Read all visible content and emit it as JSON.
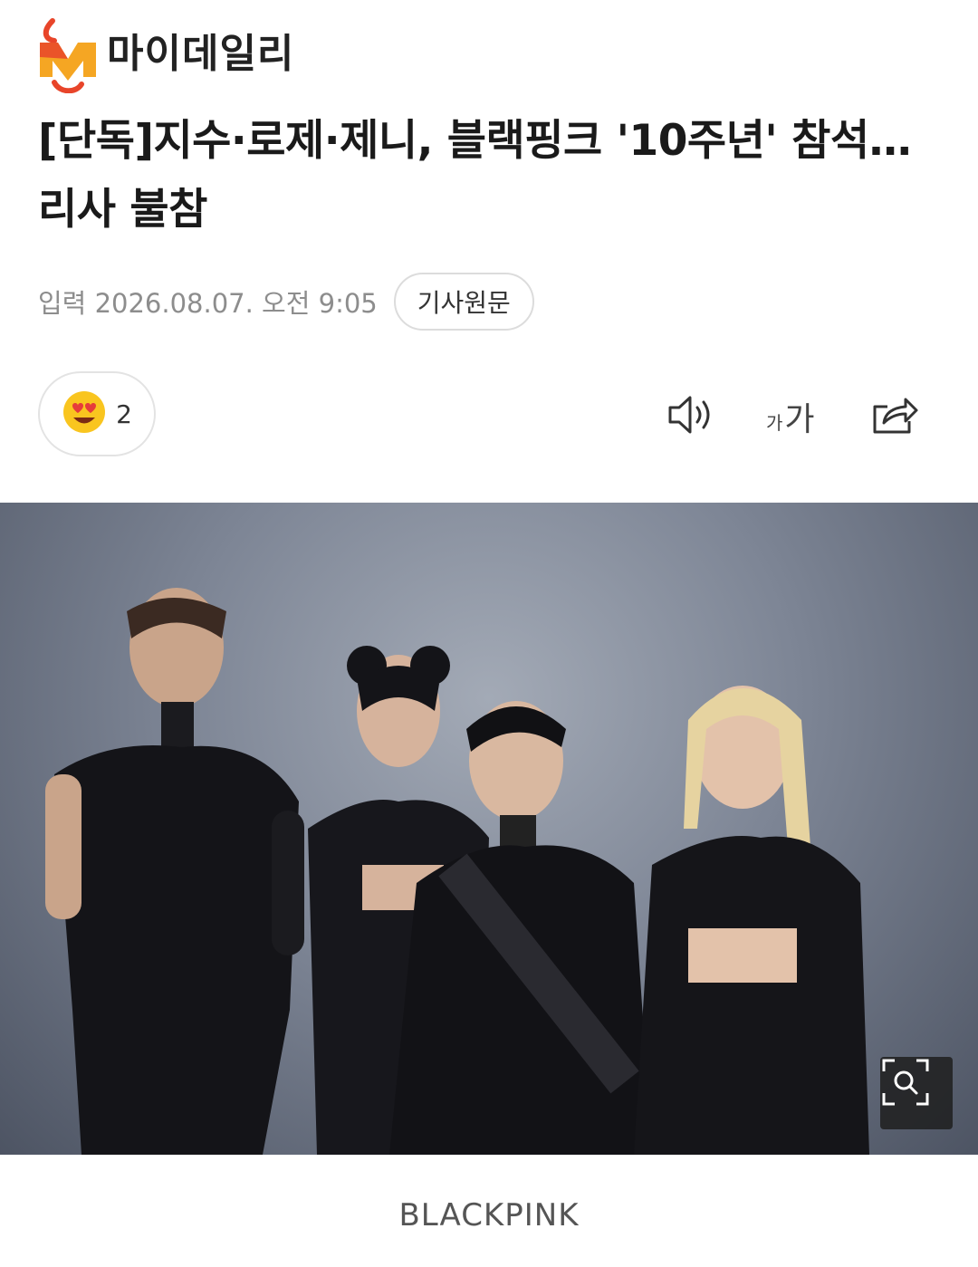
{
  "brand": {
    "name": "마이데일리",
    "accent": "#e8452a",
    "secondary": "#f5a623"
  },
  "article": {
    "headline": "[단독]지수·로제·제니, 블랙핑크 '10주년' 참석… 리사 불참",
    "date": "입력 2026.08.07. 오전 9:05",
    "source_button": "기사원문"
  },
  "actions": {
    "reaction_icon": "heart-eyes-emoji-icon",
    "reaction_count": "2",
    "speaker_icon": "speaker-icon",
    "font_small": "가",
    "font_large": "가",
    "share_icon": "share-icon"
  },
  "photo": {
    "zoom_icon": "zoom-icon"
  },
  "caption": "BLACKPINK"
}
